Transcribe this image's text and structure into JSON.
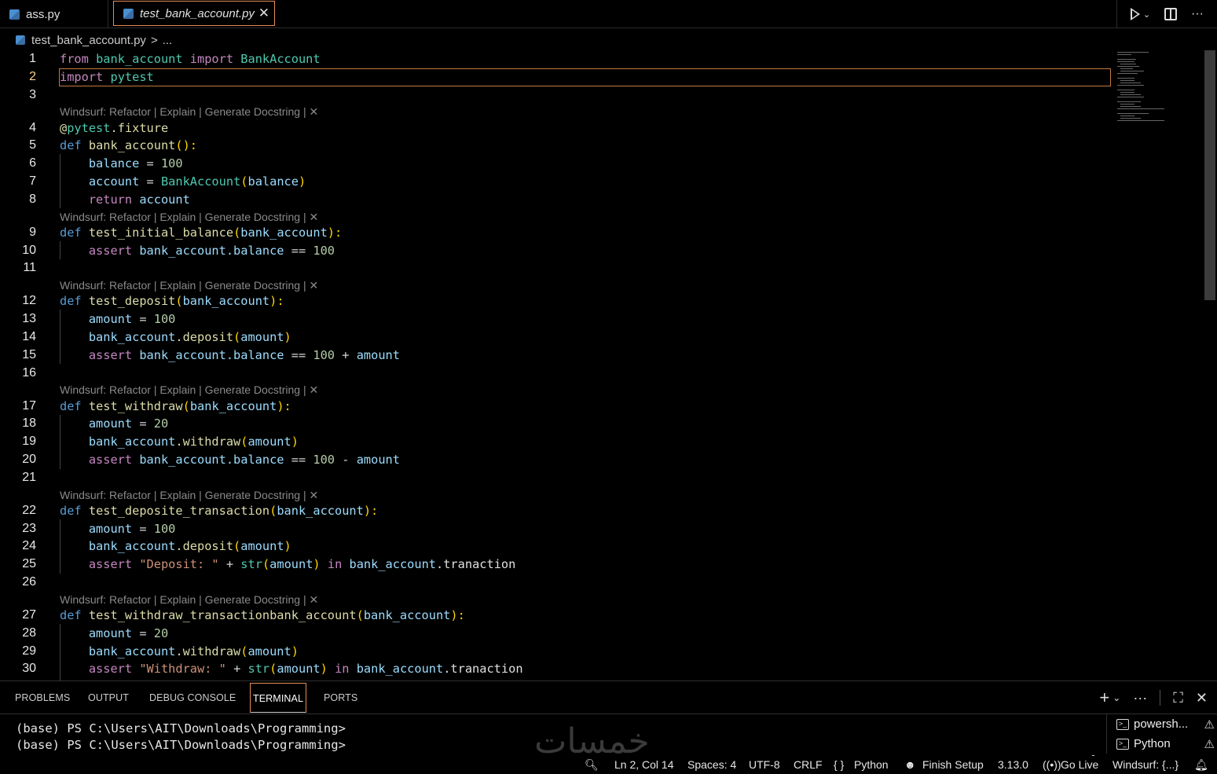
{
  "tabs": [
    {
      "label": "ass.py"
    },
    {
      "label": "test_bank_account.py"
    }
  ],
  "breadcrumb": {
    "file": "test_bank_account.py",
    "sep": ">",
    "more": "..."
  },
  "codelens": "Windsurf: Refactor | Explain | Generate Docstring | ✕",
  "panel_tabs": [
    "PROBLEMS",
    "OUTPUT",
    "DEBUG CONSOLE",
    "TERMINAL",
    "PORTS"
  ],
  "terminal": {
    "lines": [
      "(base) PS C:\\Users\\AIT\\Downloads\\Programming>",
      "(base) PS C:\\Users\\AIT\\Downloads\\Programming>"
    ],
    "list": [
      "powersh...",
      "Python"
    ]
  },
  "status": {
    "position": "Ln 2, Col 14",
    "spaces": "Spaces: 4",
    "encoding": "UTF-8",
    "eol": "CRLF",
    "language": "Python",
    "finish_setup": "Finish Setup",
    "version": "3.13.0",
    "go_live": "Go Live",
    "windsurf": "Windsurf: {...}"
  },
  "watermark": "خمسات",
  "code_lines": [
    "1",
    "2",
    "3",
    "4",
    "5",
    "6",
    "7",
    "8",
    "9",
    "10",
    "11",
    "12",
    "13",
    "14",
    "15",
    "16",
    "17",
    "18",
    "19",
    "20",
    "21",
    "22",
    "23",
    "24",
    "25",
    "26",
    "27",
    "28",
    "29",
    "30"
  ],
  "code": {
    "l1": [
      "from",
      "bank_account",
      "import",
      "BankAccount"
    ],
    "l2": [
      "import",
      "pytest"
    ],
    "l4": [
      "@",
      "pytest",
      ".fixture"
    ],
    "l5": [
      "def",
      "bank_account",
      "():"
    ],
    "l6": [
      "balance",
      "=",
      "100"
    ],
    "l7": [
      "account",
      "=",
      "BankAccount",
      "(",
      "balance",
      ")"
    ],
    "l8": [
      "return",
      "account"
    ],
    "l9": [
      "def",
      "test_initial_balance",
      "(",
      "bank_account",
      "):"
    ],
    "l10": [
      "assert",
      "bank_account",
      ".balance",
      "==",
      "100"
    ],
    "l12": [
      "def",
      "test_deposit",
      "(",
      "bank_account",
      "):"
    ],
    "l13": [
      "amount",
      "=",
      "100"
    ],
    "l14": [
      "bank_account",
      ".deposit",
      "(",
      "amount",
      ")"
    ],
    "l15": [
      "assert",
      "bank_account",
      ".balance",
      "==",
      "100",
      "+",
      "amount"
    ],
    "l17": [
      "def",
      "test_withdraw",
      "(",
      "bank_account",
      "):"
    ],
    "l18": [
      "amount",
      "=",
      "20"
    ],
    "l19": [
      "bank_account",
      ".withdraw",
      "(",
      "amount",
      ")"
    ],
    "l20": [
      "assert",
      "bank_account",
      ".balance",
      "==",
      "100",
      "-",
      "amount"
    ],
    "l22": [
      "def",
      "test_deposite_transaction",
      "(",
      "bank_account",
      "):"
    ],
    "l23": [
      "amount",
      "=",
      "100"
    ],
    "l24": [
      "bank_account",
      ".deposit",
      "(",
      "amount",
      ")"
    ],
    "l25": [
      "assert",
      "\"Deposit: \"",
      "+",
      "str",
      "(",
      "amount",
      ")",
      "in",
      "bank_account",
      ".tranaction"
    ],
    "l27": [
      "def",
      "test_withdraw_transactionbank_account",
      "(",
      "bank_account",
      "):"
    ],
    "l28": [
      "amount",
      "=",
      "20"
    ],
    "l29": [
      "bank_account",
      ".withdraw",
      "(",
      "amount",
      ")"
    ],
    "l30": [
      "assert",
      "\"Withdraw: \"",
      "+",
      "str",
      "(",
      "amount",
      ")",
      "in",
      "bank_account",
      ".tranaction"
    ]
  }
}
